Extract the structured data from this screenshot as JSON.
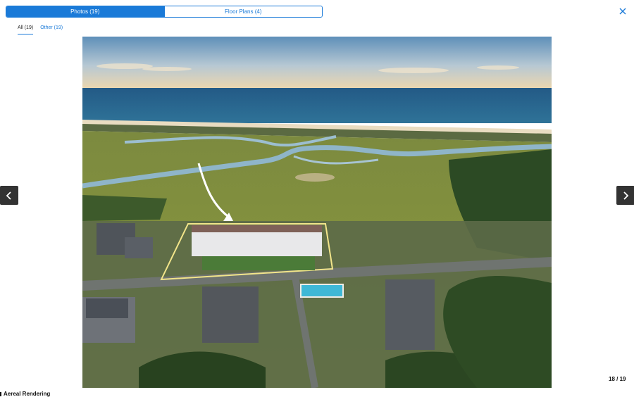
{
  "tabs": [
    {
      "label": "Photos (19)",
      "active": true
    },
    {
      "label": "Floor Plans (4)",
      "active": false
    }
  ],
  "filters": [
    {
      "label": "All (19)",
      "active": true
    },
    {
      "label": "Other (19)",
      "active": false
    }
  ],
  "photo": {
    "counter": "18 / 19",
    "caption": "Aereal Rendering"
  },
  "icons": {
    "close": "close-icon",
    "prev": "chevron-left-icon",
    "next": "chevron-right-icon"
  },
  "colors": {
    "accent": "#1a7ad8",
    "nav_bg": "#333333",
    "highlight_outline": "#f2e58a"
  }
}
